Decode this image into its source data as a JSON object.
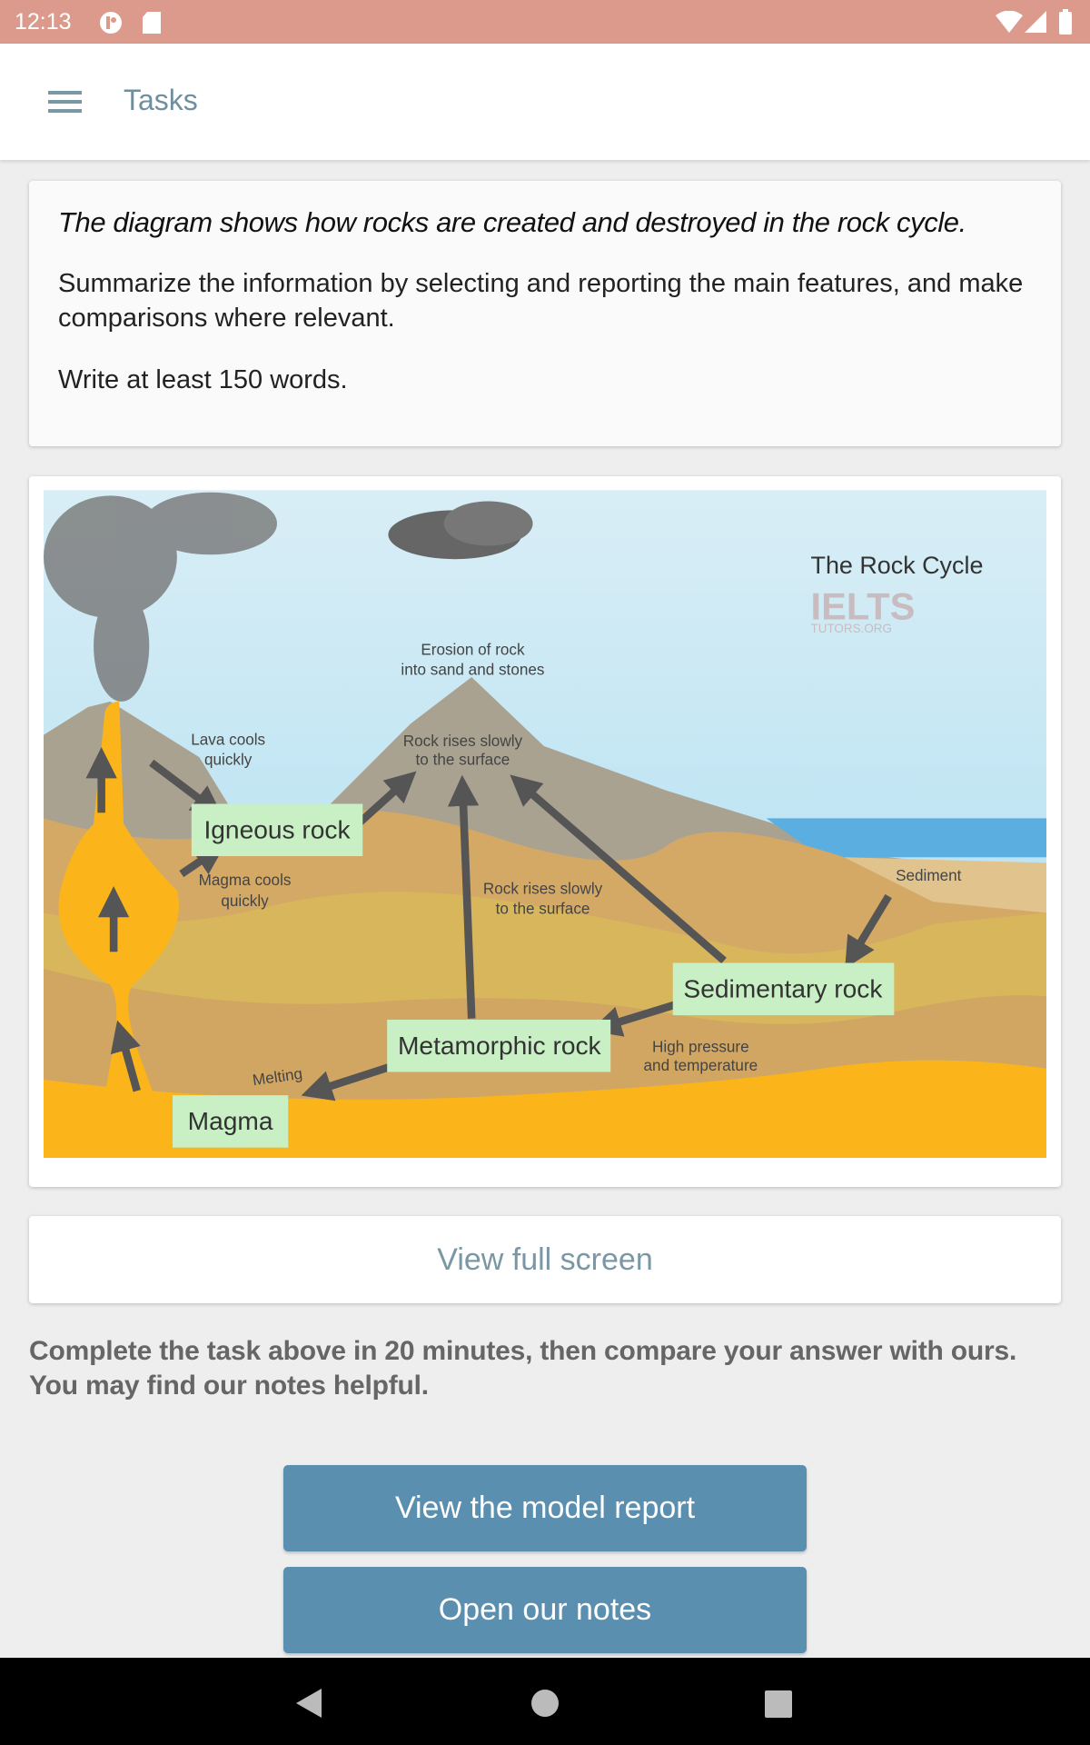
{
  "status_bar": {
    "time": "12:13",
    "icons": [
      "app-notification-icon",
      "sd-card-icon",
      "wifi-icon",
      "signal-icon",
      "battery-icon"
    ]
  },
  "app_bar": {
    "title": "Tasks",
    "menu_icon": "hamburger-menu-icon"
  },
  "task": {
    "lead": "The diagram shows how rocks are created and destroyed in the rock cycle.",
    "instruction": "Summarize the information by selecting and reporting the main features, and make comparisons where relevant.",
    "word_count": "Write at least 150 words."
  },
  "diagram": {
    "title": "The Rock Cycle",
    "watermark": "IELTS",
    "watermark_sub": "TUTORS.ORG",
    "boxes": {
      "igneous": "Igneous rock",
      "sedimentary": "Sedimentary rock",
      "metamorphic": "Metamorphic rock",
      "magma": "Magma"
    },
    "labels": {
      "erosion_1": "Erosion of rock",
      "erosion_2": "into sand and stones",
      "lava_1": "Lava cools",
      "lava_2": "quickly",
      "rise_top_1": "Rock rises slowly",
      "rise_top_2": "to the surface",
      "magma_cools_1": "Magma cools",
      "magma_cools_2": "quickly",
      "rise_mid_1": "Rock rises slowly",
      "rise_mid_2": "to the surface",
      "sediment": "Sediment",
      "pressure_1": "High pressure",
      "pressure_2": "and temperature",
      "melting": "Melting"
    }
  },
  "view_full_screen": "View full screen",
  "note": "Complete the task above in 20 minutes, then compare your answer with ours. You may find our notes helpful.",
  "buttons": {
    "model_report": "View the model report",
    "notes": "Open our notes"
  },
  "nav_bar": {
    "icons": [
      "back-icon",
      "home-icon",
      "recents-icon"
    ]
  },
  "colors": {
    "status_bar": "#dc9a8c",
    "accent": "#5b8fb0",
    "label_box": "#c8f0c4"
  }
}
